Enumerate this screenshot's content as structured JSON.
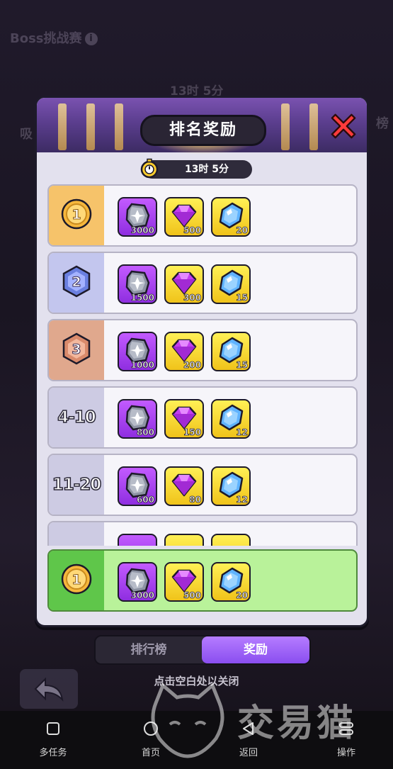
{
  "background": {
    "title": "Boss挑战赛",
    "info_icon": "info-icon",
    "timer": "13时 5分",
    "left_glyph": "吸",
    "right_glyph": "榜"
  },
  "modal": {
    "title": "排名奖励",
    "close_icon": "close-x-icon",
    "timer": "13时 5分"
  },
  "rows": [
    {
      "rank": "1",
      "rank_type": "gold-medal",
      "items": [
        {
          "icon": "stone-icon",
          "qty": "3000"
        },
        {
          "icon": "purple-gem-icon",
          "qty": "500"
        },
        {
          "icon": "blue-crystal-icon",
          "qty": "20"
        }
      ]
    },
    {
      "rank": "2",
      "rank_type": "silver-medal",
      "items": [
        {
          "icon": "stone-icon",
          "qty": "1500"
        },
        {
          "icon": "purple-gem-icon",
          "qty": "300"
        },
        {
          "icon": "blue-crystal-icon",
          "qty": "15"
        }
      ]
    },
    {
      "rank": "3",
      "rank_type": "bronze-medal",
      "items": [
        {
          "icon": "stone-icon",
          "qty": "1000"
        },
        {
          "icon": "purple-gem-icon",
          "qty": "200"
        },
        {
          "icon": "blue-crystal-icon",
          "qty": "15"
        }
      ]
    },
    {
      "rank": "4-10",
      "rank_type": "text",
      "items": [
        {
          "icon": "stone-icon",
          "qty": "800"
        },
        {
          "icon": "purple-gem-icon",
          "qty": "150"
        },
        {
          "icon": "blue-crystal-icon",
          "qty": "12"
        }
      ]
    },
    {
      "rank": "11-20",
      "rank_type": "text",
      "items": [
        {
          "icon": "stone-icon",
          "qty": "600"
        },
        {
          "icon": "purple-gem-icon",
          "qty": "80"
        },
        {
          "icon": "blue-crystal-icon",
          "qty": "12"
        }
      ]
    }
  ],
  "my_row": {
    "rank": "1",
    "items": [
      {
        "icon": "stone-icon",
        "qty": "3000"
      },
      {
        "icon": "purple-gem-icon",
        "qty": "500"
      },
      {
        "icon": "blue-crystal-icon",
        "qty": "20"
      }
    ]
  },
  "tabs": {
    "leaderboard": "排行榜",
    "rewards": "奖励",
    "active": "rewards"
  },
  "hint": "点击空白处以关闭",
  "navbar": [
    {
      "label": "多任务",
      "icon": "square-icon"
    },
    {
      "label": "首页",
      "icon": "circle-icon"
    },
    {
      "label": "返回",
      "icon": "triangle-back-icon"
    },
    {
      "label": "操作",
      "icon": "menu-icon"
    }
  ],
  "watermark": "交易猫",
  "colors": {
    "gold": "#f6b73c",
    "silver": "#6a7fe0",
    "bronze": "#d98a6b",
    "rank_cell_gold": "#f6c36a",
    "rank_cell_silver": "#c3c6ee",
    "rank_cell_bronze": "#e0a88d",
    "rank_cell_plain": "#cdcbe3",
    "my_row_cell": "#5fc64a",
    "tab_active": "#a166fb"
  }
}
